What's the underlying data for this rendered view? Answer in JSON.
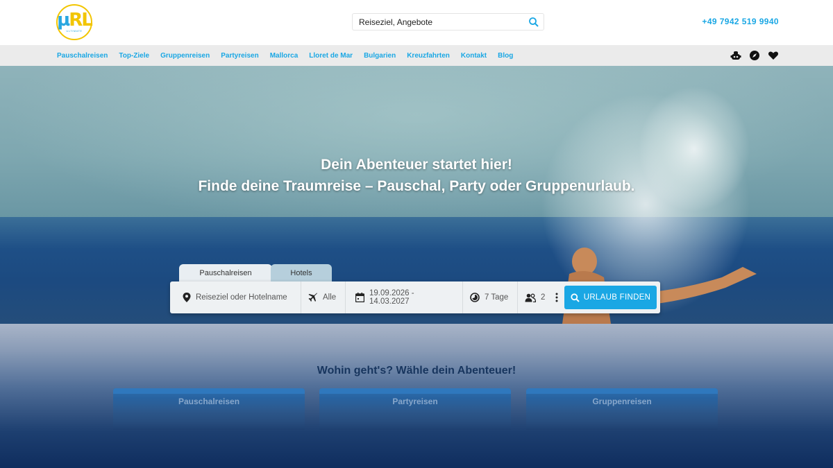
{
  "header": {
    "logo_text_1": "µ",
    "logo_text_2": "RL",
    "logo_sub": "ULTIMATE",
    "search": {
      "value": "Reiseziel, Angebote",
      "placeholder": "Reiseziel, Angebote",
      "icon": "search-icon"
    },
    "phone": "+49 7942 519 9940"
  },
  "nav": {
    "items": [
      {
        "label": "Pauschalreisen"
      },
      {
        "label": "Top-Ziele"
      },
      {
        "label": "Gruppenreisen"
      },
      {
        "label": "Partyreisen"
      },
      {
        "label": "Mallorca"
      },
      {
        "label": "Lloret de Mar"
      },
      {
        "label": "Bulgarien"
      },
      {
        "label": "Kreuzfahrten"
      },
      {
        "label": "Kontakt"
      },
      {
        "label": "Blog"
      }
    ],
    "icons": [
      "user-robot-icon",
      "compass-icon",
      "heart-icon"
    ]
  },
  "hero": {
    "title_line1": "Dein Abenteuer startet hier!",
    "title_line2": "Finde deine Traumreise – Pauschal, Party oder Gruppenurlaub."
  },
  "booking": {
    "tabs": [
      {
        "label": "Pauschalreisen",
        "active": true
      },
      {
        "label": "Hotels",
        "active": false
      }
    ],
    "destination": {
      "placeholder": "Reiseziel oder Hotelname",
      "icon": "location-pin-icon"
    },
    "airport": {
      "value": "Alle",
      "icon": "airplane-icon"
    },
    "dates": {
      "value": "19.09.2026 - 14.03.2027",
      "icon": "calendar-icon"
    },
    "duration": {
      "value": "7 Tage",
      "icon": "duration-icon"
    },
    "travellers": {
      "value": "2",
      "icon": "people-icon"
    },
    "more_icon": "more-vertical-icon",
    "submit_label": "URLAUB FINDEN"
  },
  "categories": {
    "title": "Wohin geht's? Wähle dein Abenteuer!",
    "items": [
      {
        "label": "Pauschalreisen"
      },
      {
        "label": "Partyreisen"
      },
      {
        "label": "Gruppenreisen"
      }
    ]
  },
  "colors": {
    "accent": "#1aa7e4",
    "logo_yellow": "#f2c500",
    "nav_bg": "#ebebeb",
    "section_title": "#17355e"
  }
}
